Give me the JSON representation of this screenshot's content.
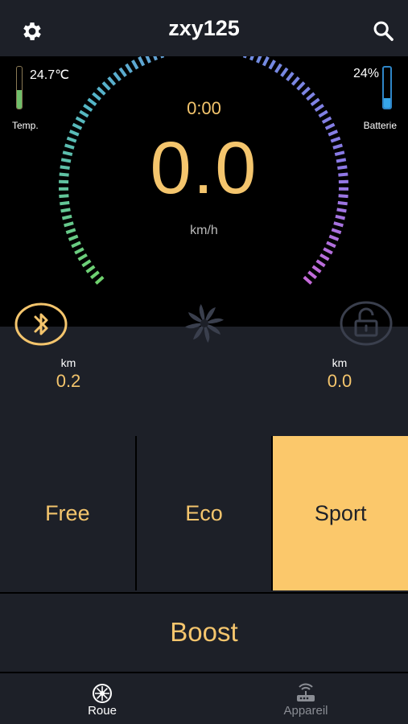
{
  "header": {
    "title": "zxy125"
  },
  "dashboard": {
    "temperature": {
      "value": "24.7℃",
      "label": "Temp.",
      "level": 0.45
    },
    "battery": {
      "value": "24%",
      "label": "Batterie",
      "level": 0.24
    },
    "timer": "0:00",
    "speed": "0.0",
    "unit": "km/h"
  },
  "trip": {
    "left": {
      "label": "km",
      "value": "0.2"
    },
    "right": {
      "label": "km",
      "value": "0.0"
    }
  },
  "modes": [
    {
      "label": "Free",
      "active": false
    },
    {
      "label": "Eco",
      "active": false
    },
    {
      "label": "Sport",
      "active": true
    }
  ],
  "boost": {
    "label": "Boost"
  },
  "nav": {
    "items": [
      {
        "label": "Roue",
        "icon": "wheel-icon",
        "active": true
      },
      {
        "label": "Appareil",
        "icon": "router-icon",
        "active": false
      }
    ]
  },
  "colors": {
    "accent": "#f4c56d",
    "active_mode": "#fbc86b",
    "background": "#1d2028",
    "inactive_nav": "#8a8d94"
  }
}
